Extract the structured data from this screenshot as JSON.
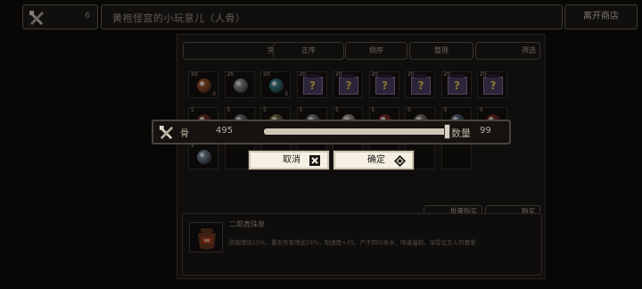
{
  "topbar": {
    "count": "6",
    "title": "黄袍怪宫的小玩意儿（人骨）",
    "leave_label": "离开商店"
  },
  "panel": {
    "sort_tabs": [
      "完整名称",
      "正序",
      "倒序",
      "整理",
      "筛选"
    ],
    "cells": [
      {
        "qty": "20",
        "stack": "3",
        "kind": "orb",
        "color": "#b0582e"
      },
      {
        "qty": "20",
        "stack": "",
        "kind": "orb",
        "color": "#9a9fa6"
      },
      {
        "qty": "20",
        "stack": "3",
        "kind": "orb",
        "color": "#3b8c9a"
      },
      {
        "qty": "20",
        "stack": "",
        "kind": "mystery",
        "mark": "?"
      },
      {
        "qty": "20",
        "stack": "",
        "kind": "mystery",
        "mark": "?"
      },
      {
        "qty": "20",
        "stack": "",
        "kind": "mystery",
        "mark": "?"
      },
      {
        "qty": "20",
        "stack": "",
        "kind": "mystery",
        "mark": "?"
      },
      {
        "qty": "20",
        "stack": "",
        "kind": "mystery",
        "mark": "?"
      },
      {
        "qty": "20",
        "stack": "",
        "kind": "mystery",
        "mark": "?"
      },
      {
        "qty": "5",
        "stack": "",
        "kind": "orb",
        "color": "#7c3a2b"
      },
      {
        "qty": "5",
        "stack": "",
        "kind": "orb",
        "color": "#7e7a82"
      },
      {
        "qty": "5",
        "stack": "",
        "kind": "orb",
        "color": "#8c7a52"
      },
      {
        "qty": "5",
        "stack": "",
        "kind": "orb",
        "color": "#8a8e96"
      },
      {
        "qty": "5",
        "stack": "",
        "kind": "orb",
        "color": "#b7b1a6"
      },
      {
        "qty": "5",
        "stack": "",
        "kind": "orb",
        "color": "#8c3026"
      },
      {
        "qty": "5",
        "stack": "",
        "kind": "orb",
        "color": "#8e8a80"
      },
      {
        "qty": "5",
        "stack": "",
        "kind": "orb",
        "color": "#5e7390"
      },
      {
        "qty": "5",
        "stack": "10",
        "kind": "orb",
        "color": "#7a2c22"
      },
      {
        "qty": "5",
        "stack": "",
        "kind": "orb",
        "color": "#7d8fa8"
      }
    ],
    "detail": {
      "name": "二郎真珠泉",
      "desc": "防御增加15%，暴击伤害增加15%，耐速度+25。产于四川赤水，味道温和，深受北方人的喜爱"
    },
    "bulk_buy_label": "批量购买",
    "buy_label": "购买"
  },
  "dialog": {
    "item_name": "骨",
    "owned": "495",
    "quantity_label": "数量",
    "quantity_value": "99",
    "slider_level": 1.0,
    "cancel_label": "取消",
    "confirm_label": "确定"
  },
  "colors": {
    "button_bg": "#f5f0e3",
    "panel_bg": "#1c1917",
    "mystery_box": "#4c3f62"
  }
}
